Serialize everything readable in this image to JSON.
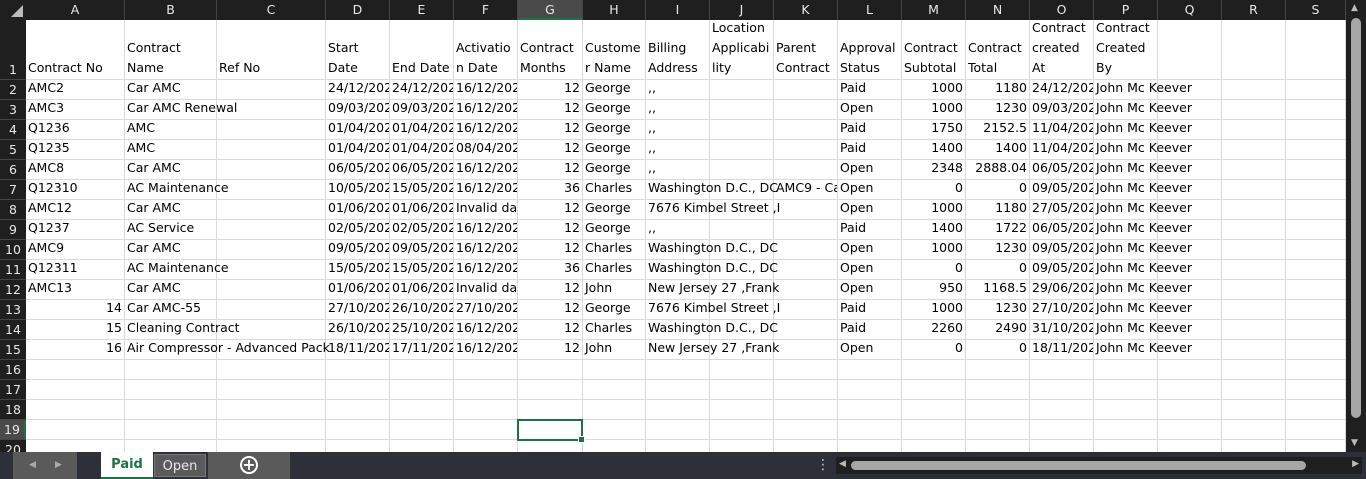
{
  "columns": [
    "A",
    "B",
    "C",
    "D",
    "E",
    "F",
    "G",
    "H",
    "I",
    "J",
    "K",
    "L",
    "M",
    "N",
    "O",
    "P",
    "Q",
    "R",
    "S"
  ],
  "selected_cell": {
    "col": "G",
    "row": 19
  },
  "headers": [
    "Contract No",
    "Contract Name",
    "Ref No",
    "Start Date",
    "End Date",
    "Activatio n Date",
    "Contract Months",
    "Custome r Name",
    "Billing Address",
    "Location Applicabi lity",
    "Parent Contract",
    "Approval Status",
    "Contract Subtotal",
    "Contract Total",
    "Contract created At",
    "Contract Created By",
    "",
    "",
    ""
  ],
  "rows": [
    [
      "AMC2",
      "Car AMC",
      "",
      "24/12/202",
      "24/12/202",
      "16/12/202",
      "12",
      "George",
      ",,",
      "",
      "",
      "Paid",
      "1000",
      "1180",
      "24/12/202",
      "John Mc Keever"
    ],
    [
      "AMC3",
      "Car AMC Renewal",
      "",
      "09/03/202",
      "09/03/202",
      "16/12/202",
      "12",
      "George",
      ",,",
      "",
      "",
      "Open",
      "1000",
      "1230",
      "09/03/202",
      "John Mc Keever"
    ],
    [
      "Q1236",
      "AMC",
      "",
      "01/04/202",
      "01/04/202",
      "16/12/202",
      "12",
      "George",
      ",,",
      "",
      "",
      "Paid",
      "1750",
      "2152.5",
      "11/04/202",
      "John Mc Keever"
    ],
    [
      "Q1235",
      "AMC",
      "",
      "01/04/202",
      "01/04/202",
      "08/04/202",
      "12",
      "George",
      ",,",
      "",
      "",
      "Paid",
      "1400",
      "1400",
      "11/04/202",
      "John Mc Keever"
    ],
    [
      "AMC8",
      "Car AMC",
      "",
      "06/05/202",
      "06/05/202",
      "16/12/202",
      "12",
      "George",
      ",,",
      "",
      "",
      "Open",
      "2348",
      "2888.04",
      "06/05/202",
      "John Mc Keever"
    ],
    [
      "Q12310",
      "AC Maintenance",
      "",
      "10/05/202",
      "15/05/202",
      "16/12/202",
      "36",
      "Charles",
      "Washington D.C., DC",
      "",
      "AMC9 - Ca",
      "Open",
      "0",
      "0",
      "09/05/202",
      "John Mc Keever"
    ],
    [
      "AMC12",
      "Car AMC",
      "",
      "01/06/202",
      "01/06/202",
      "Invalid da",
      "12",
      "George",
      "7676 Kimbel Street ,I",
      "",
      "",
      "Open",
      "1000",
      "1180",
      "27/05/202",
      "John Mc Keever"
    ],
    [
      "Q1237",
      "AC Service",
      "",
      "02/05/202",
      "02/05/202",
      "16/12/202",
      "12",
      "George",
      ",,",
      "",
      "",
      "Paid",
      "1400",
      "1722",
      "06/05/202",
      "John Mc Keever"
    ],
    [
      "AMC9",
      "Car AMC",
      "",
      "09/05/202",
      "09/05/202",
      "16/12/202",
      "12",
      "Charles",
      "Washington D.C., DC",
      "",
      "",
      "Open",
      "1000",
      "1230",
      "09/05/202",
      "John Mc Keever"
    ],
    [
      "Q12311",
      "AC Maintenance",
      "",
      "15/05/202",
      "15/05/202",
      "16/12/202",
      "36",
      "Charles",
      "Washington D.C., DC",
      "",
      "",
      "Open",
      "0",
      "0",
      "09/05/202",
      "John Mc Keever"
    ],
    [
      "AMC13",
      "Car AMC",
      "",
      "01/06/202",
      "01/06/202",
      "Invalid da",
      "12",
      "John",
      "New Jersey 27 ,Frank",
      "",
      "",
      "Open",
      "950",
      "1168.5",
      "29/06/202",
      "John Mc Keever"
    ],
    [
      "14",
      "Car AMC-55",
      "",
      "27/10/202",
      "26/10/202",
      "27/10/202",
      "12",
      "George",
      "7676 Kimbel Street ,I",
      "",
      "",
      "Paid",
      "1000",
      "1230",
      "27/10/202",
      "John Mc Keever"
    ],
    [
      "15",
      "Cleaning Contract",
      "",
      "26/10/202",
      "25/10/202",
      "16/12/202",
      "12",
      "Charles",
      "Washington D.C., DC",
      "",
      "",
      "Paid",
      "2260",
      "2490",
      "31/10/202",
      "John Mc Keever"
    ],
    [
      "16",
      "Air Compressor - Advanced Pack",
      "",
      "18/11/202",
      "17/11/202",
      "16/12/202",
      "12",
      "John",
      "New Jersey 27 ,Frank",
      "",
      "",
      "Open",
      "0",
      "0",
      "18/11/202",
      "John Mc Keever"
    ]
  ],
  "row_numbers": [
    "1",
    "2",
    "3",
    "4",
    "5",
    "6",
    "7",
    "8",
    "9",
    "10",
    "11",
    "12",
    "13",
    "14",
    "15",
    "16",
    "17",
    "18",
    "19",
    "20"
  ],
  "sheet_tabs": {
    "active": "Paid",
    "other": "Open"
  },
  "new_sheet_label": "+",
  "more_label": "⋮"
}
